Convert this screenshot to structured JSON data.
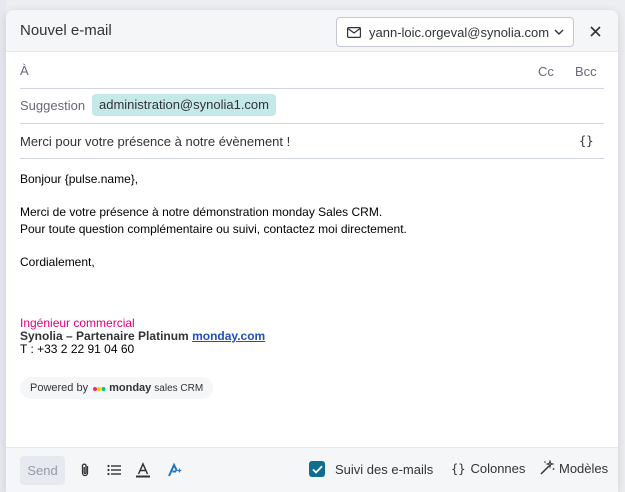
{
  "header": {
    "title": "Nouvel e-mail",
    "from_address": "yann-loic.orgeval@synolia.com"
  },
  "to": {
    "label": "À",
    "cc_label": "Cc",
    "bcc_label": "Bcc"
  },
  "suggestion": {
    "label": "Suggestion",
    "email": "administration@synolia1.com"
  },
  "subject": {
    "text": "Merci pour votre présence à notre évènement !",
    "variable_icon": "{}"
  },
  "body": {
    "greeting": "Bonjour {pulse.name},",
    "line1": "Merci de votre présence à notre démonstration monday Sales CRM.",
    "line2": "Pour toute question complémentaire ou suivi, contactez moi directement.",
    "closing": "Cordialement,"
  },
  "signature": {
    "role": "Ingénieur commercial",
    "company": "Synolia – Partenaire Platinum",
    "link": "monday.com",
    "phone": "T : +33 2 22 91 04 60"
  },
  "powered_by": {
    "prefix": "Powered by",
    "brand": "monday",
    "product": "sales CRM"
  },
  "footer": {
    "send_label": "Send",
    "track_label": "Suivi des e-mails",
    "track_checked": true,
    "columns_icon": "{}",
    "columns_label": "Colonnes",
    "templates_label": "Modèles"
  },
  "icons": [
    "mail-icon",
    "chevron-down-icon",
    "close-icon",
    "paperclip-icon",
    "list-icon",
    "text-color-icon",
    "ai-assistant-icon",
    "check-icon",
    "magic-wand-icon",
    "monday-logo-icon"
  ],
  "colors": {
    "chip_bg": "#c5e8e8",
    "signature_role": "#e2007a",
    "link": "#1f4fc1",
    "checkbox": "#0f6e8f",
    "ai_icon": "#1f76c2"
  }
}
